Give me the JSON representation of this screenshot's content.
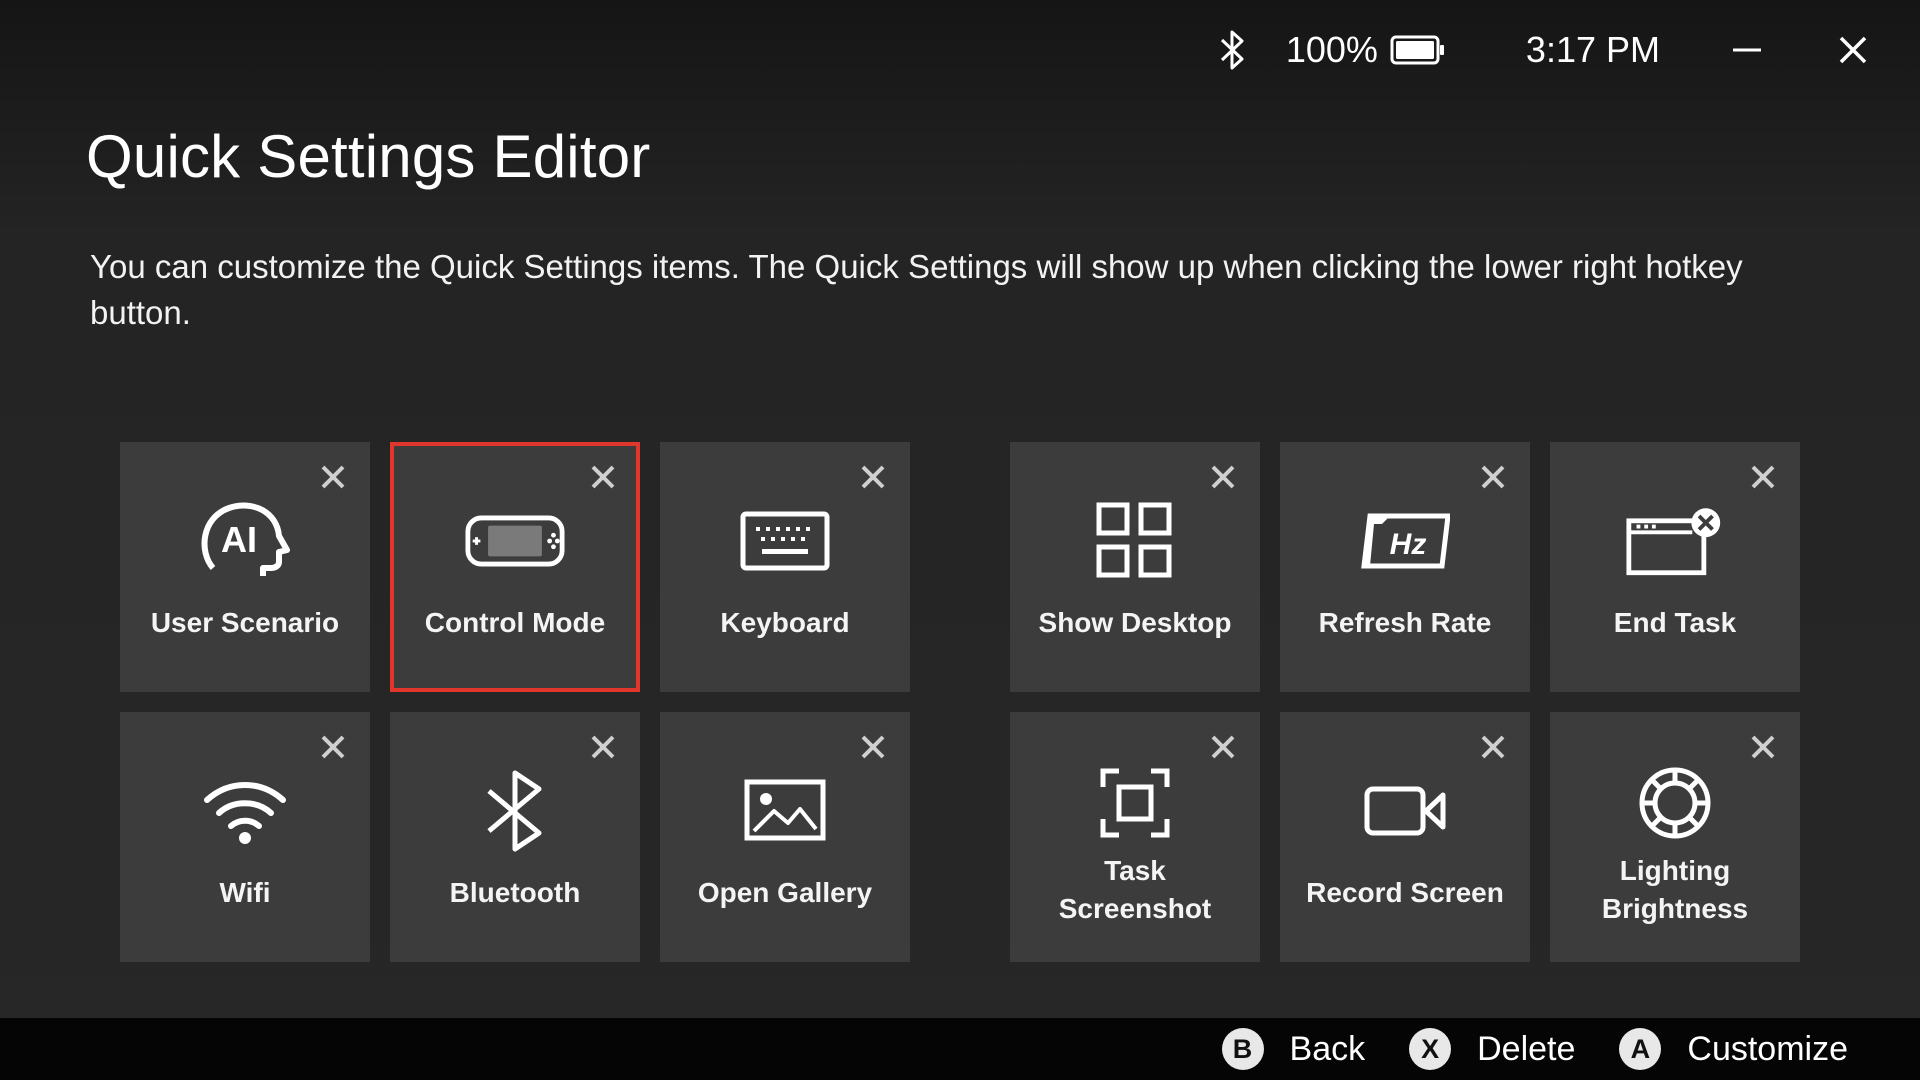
{
  "status": {
    "battery_text": "100%",
    "battery_level": 1.0,
    "time": "3:17 PM"
  },
  "page": {
    "title": "Quick Settings Editor",
    "description": "You can customize the Quick Settings items. The Quick Settings will show up when clicking the lower right hotkey button."
  },
  "tiles": [
    {
      "label": "User Scenario",
      "icon": "ai-head-icon",
      "selected": false
    },
    {
      "label": "Control Mode",
      "icon": "handheld-console-icon",
      "selected": true
    },
    {
      "label": "Keyboard",
      "icon": "keyboard-icon",
      "selected": false
    },
    {
      "label": "Show Desktop",
      "icon": "four-squares-icon",
      "selected": false
    },
    {
      "label": "Refresh Rate",
      "icon": "hz-icon",
      "selected": false
    },
    {
      "label": "End Task",
      "icon": "window-close-icon",
      "selected": false
    },
    {
      "label": "Wifi",
      "icon": "wifi-icon",
      "selected": false
    },
    {
      "label": "Bluetooth",
      "icon": "bluetooth-icon",
      "selected": false
    },
    {
      "label": "Open Gallery",
      "icon": "image-icon",
      "selected": false
    },
    {
      "label_line1": "Task",
      "label_line2": "Screenshot",
      "icon": "screenshot-frame-icon",
      "selected": false
    },
    {
      "label": "Record Screen",
      "icon": "video-camera-icon",
      "selected": false
    },
    {
      "label_line1": "Lighting",
      "label_line2": "Brightness",
      "icon": "lighting-ring-icon",
      "selected": false
    }
  ],
  "footer": {
    "back": {
      "key": "B",
      "label": "Back"
    },
    "delete": {
      "key": "X",
      "label": "Delete"
    },
    "customize": {
      "key": "A",
      "label": "Customize"
    }
  },
  "colors": {
    "tile_bg": "#3c3c3c",
    "selection": "#e0362c",
    "footer_bg": "#050505"
  }
}
